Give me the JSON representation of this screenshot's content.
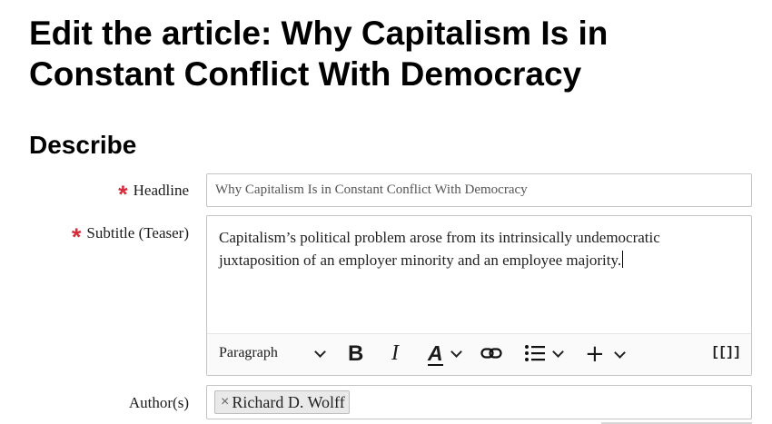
{
  "page": {
    "title": "Edit the article: Why Capitalism Is in Constant Conflict With Democracy",
    "section_title": "Describe"
  },
  "form": {
    "required_mark": "*",
    "headline": {
      "label": "Headline",
      "value": "Why Capitalism Is in Constant Conflict With Democracy"
    },
    "subtitle": {
      "label": "Subtitle (Teaser)",
      "value": "Capitalism’s political problem arose from its intrinsically undemocratic juxtaposition of an employer minority and an employee majority."
    },
    "authors": {
      "label": "Author(s)",
      "chips": [
        {
          "remove_glyph": "×",
          "name": "Richard D. Wolff"
        }
      ]
    }
  },
  "toolbar": {
    "paragraph_label": "Paragraph",
    "bold_label": "B",
    "italic_label": "I",
    "font_color_label": "A",
    "insert_label": "+",
    "source_label": "[[]]",
    "icons": [
      "chevron-down-icon",
      "bold-icon",
      "italic-icon",
      "font-color-icon",
      "link-icon",
      "bulleted-list-icon",
      "insert-icon",
      "source-icon"
    ]
  },
  "colors": {
    "required": "#d72a3b",
    "border": "#c4c4c4",
    "chip_bg": "#e9e9e9"
  }
}
